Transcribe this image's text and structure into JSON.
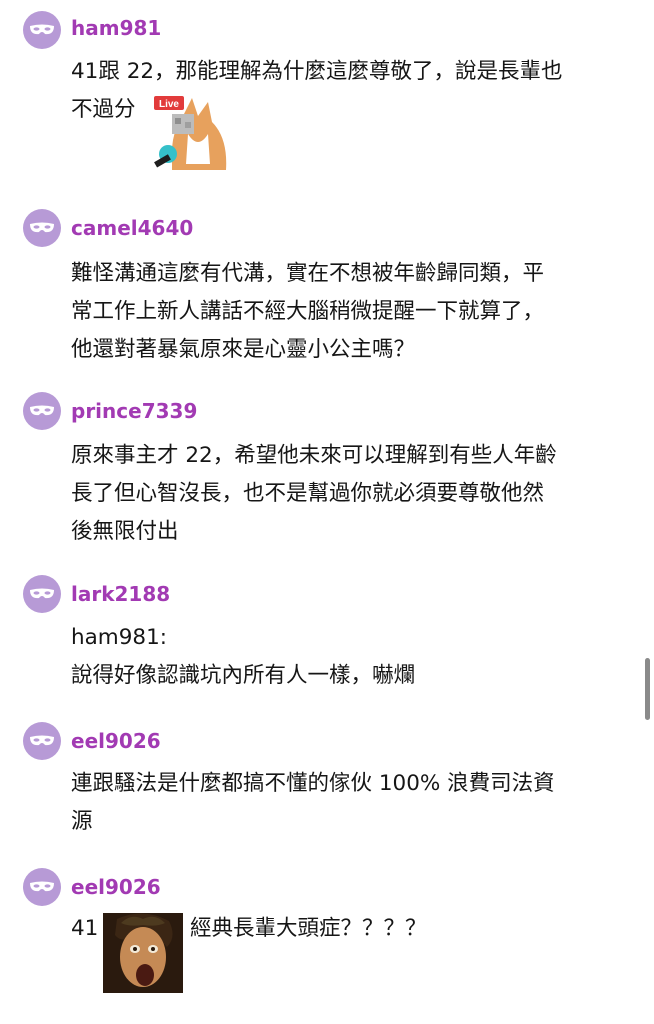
{
  "comments": [
    {
      "username": "ham981",
      "lines": [
        "41跟 22，那能理解為什麼這麼尊敬了，說是長輩也",
        "不過分"
      ],
      "sticker": "live-fox-microphone-sticker",
      "sticker_label": "Live"
    },
    {
      "username": "camel4640",
      "lines": [
        "難怪溝通這麼有代溝，實在不想被年齡歸同類，平",
        "常工作上新人講話不經大腦稍微提醒一下就算了，",
        "他還對著暴氣原來是心靈小公主嗎？"
      ]
    },
    {
      "username": "prince7339",
      "lines": [
        "原來事主才 22，希望他未來可以理解到有些人年齡",
        "長了但心智沒長，也不是幫過你就必須要尊敬他然",
        "後無限付出"
      ]
    },
    {
      "username": "lark2188",
      "lines": [
        "ham981:",
        "說得好像認識坑內所有人一樣，嚇爛"
      ]
    },
    {
      "username": "eel9026",
      "lines": [
        "連跟騷法是什麼都搞不懂的傢伙 100% 浪費司法資",
        "源"
      ]
    },
    {
      "username": "eel9026",
      "text_before": "41",
      "text_after": "經典長輩大頭症？？？？",
      "sticker": "screaming-face-painting-sticker"
    }
  ],
  "colors": {
    "avatar_bg": "#b79ad6",
    "username": "#a23ab3",
    "text": "#161616"
  },
  "icons": {
    "avatar": "mask-icon"
  }
}
